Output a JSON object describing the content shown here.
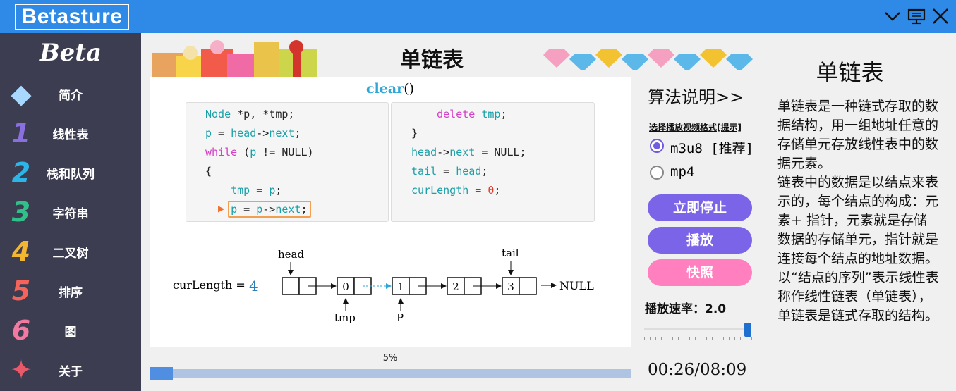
{
  "app": {
    "brand": "Betasture",
    "logo": "Beta"
  },
  "sidebar": {
    "items": [
      {
        "label": "简介",
        "icon": "diamond-icon"
      },
      {
        "label": "线性表",
        "icon": "number-1-icon"
      },
      {
        "label": "栈和队列",
        "icon": "number-2-icon"
      },
      {
        "label": "字符串",
        "icon": "number-3-icon"
      },
      {
        "label": "二叉树",
        "icon": "number-4-icon"
      },
      {
        "label": "排序",
        "icon": "number-5-icon"
      },
      {
        "label": "图",
        "icon": "number-6-icon"
      },
      {
        "label": "关于",
        "icon": "origami-bird-icon"
      }
    ],
    "icon_glyphs": [
      "◆",
      "1",
      "2",
      "3",
      "4",
      "5",
      "6",
      "✦"
    ],
    "icon_colors": [
      "#a9d8ff",
      "#8a6fe0",
      "#2cb6e8",
      "#30c08a",
      "#f2b630",
      "#f5645a",
      "#f27aa0",
      "#e85a6a"
    ]
  },
  "main": {
    "title": "单链表",
    "func_name": "clear",
    "func_parens": "()",
    "code_left": [
      [
        {
          "t": "Node",
          "c": "ty"
        },
        {
          "t": " *p, *tmp;"
        }
      ],
      [
        {
          "t": "p",
          "c": "ty"
        },
        {
          "t": " = "
        },
        {
          "t": "head",
          "c": "ty"
        },
        {
          "t": "->"
        },
        {
          "t": "next",
          "c": "ty"
        },
        {
          "t": ";"
        }
      ],
      [
        {
          "t": "while",
          "c": "kw"
        },
        {
          "t": " ("
        },
        {
          "t": "p",
          "c": "ty"
        },
        {
          "t": " != NULL)"
        }
      ],
      [
        {
          "t": "{"
        }
      ],
      [
        {
          "t": "    tmp",
          "c": "ty"
        },
        {
          "t": " = "
        },
        {
          "t": "p",
          "c": "ty"
        },
        {
          "t": ";"
        }
      ],
      [
        {
          "t": "    p",
          "c": "ty"
        },
        {
          "t": " = "
        },
        {
          "t": "p",
          "c": "ty"
        },
        {
          "t": "->"
        },
        {
          "t": "next",
          "c": "ty"
        },
        {
          "t": ";"
        }
      ]
    ],
    "code_right": [
      [
        {
          "t": "    delete",
          "c": "kw"
        },
        {
          "t": " "
        },
        {
          "t": "tmp",
          "c": "ty"
        },
        {
          "t": ";"
        }
      ],
      [
        {
          "t": "}"
        }
      ],
      [
        {
          "t": "head",
          "c": "ty"
        },
        {
          "t": "->"
        },
        {
          "t": "next",
          "c": "ty"
        },
        {
          "t": " = NULL;"
        }
      ],
      [
        {
          "t": "tail",
          "c": "ty"
        },
        {
          "t": " = "
        },
        {
          "t": "head",
          "c": "ty"
        },
        {
          "t": ";"
        }
      ],
      [
        {
          "t": "curLength",
          "c": "ty"
        },
        {
          "t": " = "
        },
        {
          "t": "0",
          "c": "num"
        },
        {
          "t": ";"
        }
      ]
    ],
    "diagram": {
      "curlength_label": "curLength =",
      "curlength_value": "4",
      "head_label": "head",
      "tail_label": "tail",
      "tmp_label": "tmp",
      "p_label": "P",
      "null_label": "NULL",
      "nodes": [
        "",
        "0",
        "1",
        "2",
        "3"
      ]
    },
    "progress": {
      "label": "5%",
      "value": 0.05
    }
  },
  "controls": {
    "algo_title": "算法说明>>",
    "format_label": "选择播放视频格式[提示]",
    "format_options": [
      {
        "label": "m3u8 [推荐]",
        "selected": true
      },
      {
        "label": "mp4",
        "selected": false
      }
    ],
    "btn_stop": "立即停止",
    "btn_play": "播放",
    "btn_snapshot": "快照",
    "speed_label": "播放速率：2.0",
    "speed_value": 2.0,
    "time": "00:26/08:09",
    "colors": {
      "stop": "#7b64e8",
      "play": "#7b64e8",
      "snapshot": "#ff7fbf",
      "accent": "#2e8ae6"
    }
  },
  "description": {
    "title": "单链表",
    "text": "单链表是一种链式存取的数据结构，用一组地址任意的存储单元存放线性表中的数据元素。\n链表中的数据是以结点来表示的，每个结点的构成：元素+ 指针，元素就是存储数据的存储单元，指针就是连接每个结点的地址数据。\n以“结点的序列”表示线性表称作线性链表（单链表），单链表是链式存取的结构。"
  }
}
